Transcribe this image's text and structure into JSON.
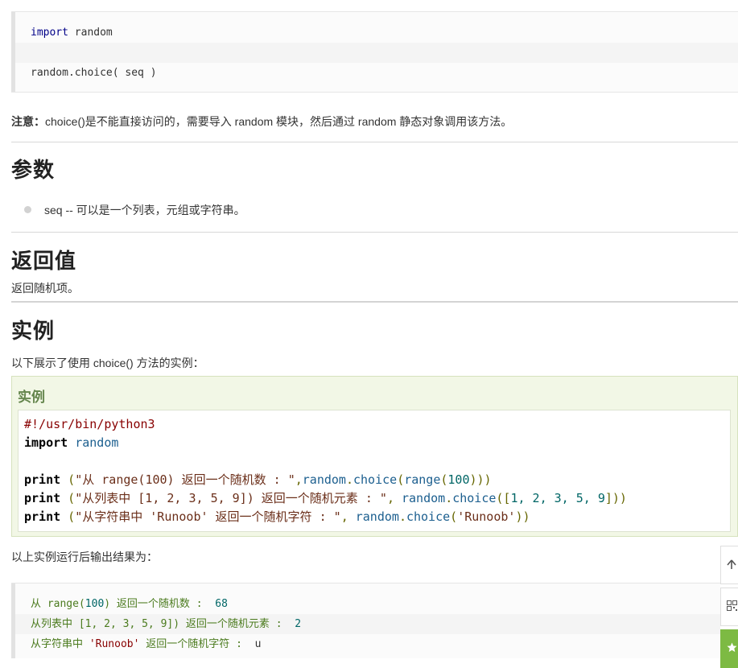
{
  "syntax": {
    "line1_kw": "import",
    "line1_rest": " random",
    "line3": "random.choice( seq  )"
  },
  "note": {
    "label": "注意：",
    "text": "choice()是不能直接访问的，需要导入 random 模块，然后通过 random 静态对象调用该方法。"
  },
  "sections": {
    "params_title": "参数",
    "param_item": "seq -- 可以是一个列表，元组或字符串。",
    "return_title": "返回值",
    "return_text": "返回随机项。",
    "example_title": "实例",
    "example_intro": "以下展示了使用 choice() 方法的实例："
  },
  "example": {
    "panel_title": "实例",
    "code": {
      "shebang": "#!/usr/bin/python3",
      "import_kw": "import",
      "import_mod": "random",
      "print_kw": "print",
      "l4_open": " (",
      "l4_str": "\"从 range(100) 返回一个随机数 : \"",
      "l4_rest_a": ",",
      "l4_mod": "random",
      "l4_dot": ".",
      "l4_fn": "choice",
      "l4_args_a": "(",
      "l4_range": "range",
      "l4_args_b": "(",
      "l4_num": "100",
      "l4_close": ")))",
      "l5_str": "\"从列表中 [1, 2, 3, 5, 9]) 返回一个随机元素 : \"",
      "l5_sep": ", ",
      "l5_args": "([",
      "l5_nums": "1, 2, 3, 5, 9",
      "l5_close": "]))",
      "l6_str": "\"从字符串中 'Runoob' 返回一个随机字符 : \"",
      "l6_sep": ", ",
      "l6_args": "(",
      "l6_arg": "'Runoob'",
      "l6_close": "))"
    }
  },
  "output_intro": "以上实例运行后输出结果为：",
  "output": {
    "o1_a": "从 range(",
    "o1_num": "100",
    "o1_b": ") 返回一个随机数 :  ",
    "o1_val": "68",
    "o2_a": "从列表中 [1, 2, 3, 5, 9]) 返回一个随机元素 :  ",
    "o2_val": "2",
    "o3_a": "从字符串中 ",
    "o3_str": "'Runoob'",
    "o3_b": " 返回一个随机字符 :  ",
    "o3_val": "u"
  },
  "toolbar": {
    "icons": [
      "arrow-up-icon",
      "qrcode-icon",
      "star-icon"
    ]
  }
}
